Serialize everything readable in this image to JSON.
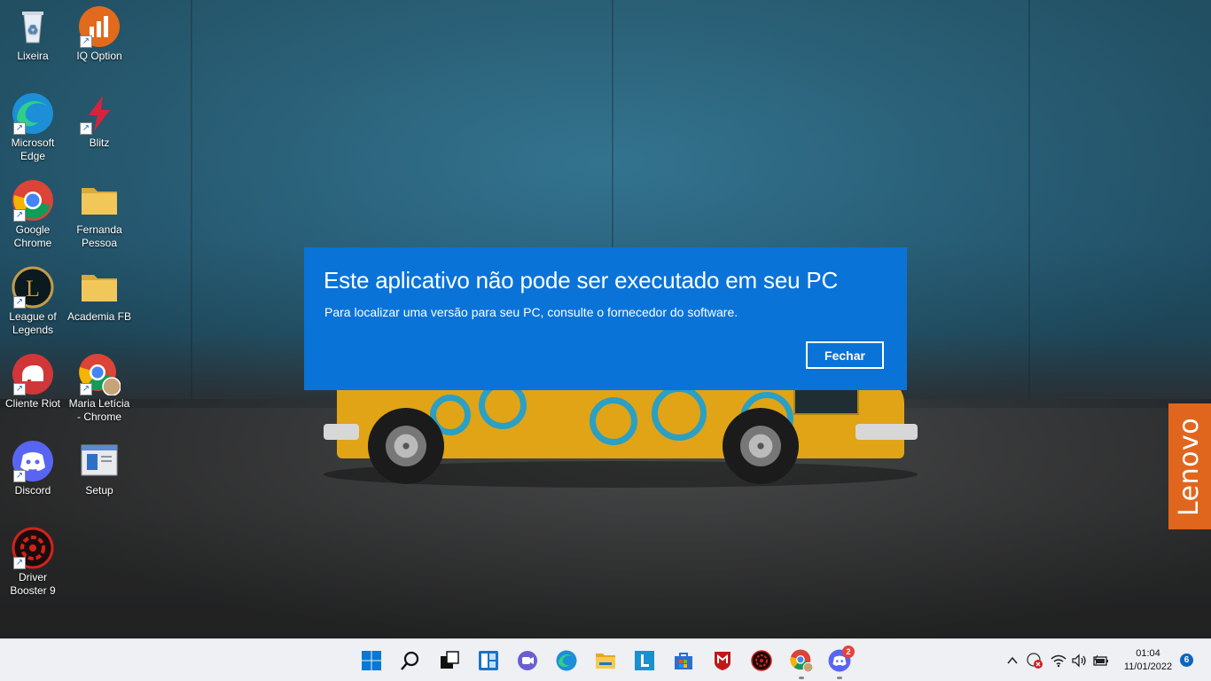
{
  "desktop": {
    "icons": [
      {
        "label": "Lixeira",
        "icon": "recycle-bin-icon"
      },
      {
        "label": "IQ Option",
        "icon": "iq-option-icon"
      },
      {
        "label": "Microsoft Edge",
        "icon": "edge-icon"
      },
      {
        "label": "Blitz",
        "icon": "blitz-icon"
      },
      {
        "label": "Google Chrome",
        "icon": "chrome-icon"
      },
      {
        "label": "Fernanda Pessoa",
        "icon": "folder-icon"
      },
      {
        "label": "League of Legends",
        "icon": "league-of-legends-icon"
      },
      {
        "label": "Academia FB",
        "icon": "folder-icon"
      },
      {
        "label": "Cliente Riot",
        "icon": "riot-client-icon"
      },
      {
        "label": "Maria Letícia - Chrome",
        "icon": "chrome-profile-icon"
      },
      {
        "label": "Discord",
        "icon": "discord-icon"
      },
      {
        "label": "Setup",
        "icon": "setup-icon"
      },
      {
        "label": "Driver Booster 9",
        "icon": "driver-booster-icon"
      }
    ]
  },
  "wallpaper_brand": "Lenovo",
  "dialog": {
    "title": "Este aplicativo não pode ser executado em seu PC",
    "message": "Para localizar uma versão para seu PC, consulte o fornecedor do software.",
    "close_label": "Fechar",
    "bg_color": "#0a73d8"
  },
  "taskbar": {
    "items": [
      {
        "name": "start-icon"
      },
      {
        "name": "search-icon"
      },
      {
        "name": "task-view-icon"
      },
      {
        "name": "widgets-icon"
      },
      {
        "name": "teams-chat-icon"
      },
      {
        "name": "edge-icon"
      },
      {
        "name": "file-explorer-icon"
      },
      {
        "name": "lenovo-vantage-icon"
      },
      {
        "name": "store-icon"
      },
      {
        "name": "mcafee-icon"
      },
      {
        "name": "driver-booster-icon"
      },
      {
        "name": "chrome-profile-icon"
      },
      {
        "name": "discord-icon",
        "badge": "2"
      }
    ],
    "tray": {
      "time": "01:04",
      "date": "11/01/2022",
      "notifications": "6"
    }
  }
}
